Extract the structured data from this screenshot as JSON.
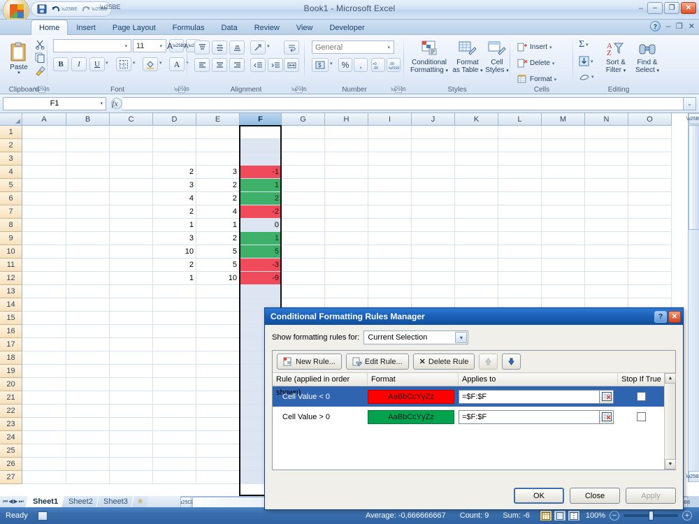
{
  "window": {
    "title": "Book1 - Microsoft Excel",
    "quick_access": [
      {
        "name": "save-icon",
        "glyph": "💾"
      },
      {
        "name": "undo-icon",
        "glyph": "↶"
      },
      {
        "name": "redo-icon",
        "glyph": "↷"
      }
    ],
    "customize_glyph": "▾",
    "minimize": "–",
    "maximize": "❐",
    "close": "✕",
    "restore_dash": "–"
  },
  "ribbon": {
    "tabs": [
      {
        "label": "Home",
        "active": true
      },
      {
        "label": "Insert",
        "active": false
      },
      {
        "label": "Page Layout",
        "active": false
      },
      {
        "label": "Formulas",
        "active": false
      },
      {
        "label": "Data",
        "active": false
      },
      {
        "label": "Review",
        "active": false
      },
      {
        "label": "View",
        "active": false
      },
      {
        "label": "Developer",
        "active": false
      }
    ],
    "help_label": "?",
    "ribbon_minimize": "–",
    "ribbon_restore": "❐",
    "ribbon_close": "✕",
    "groups": {
      "clipboard": {
        "label": "Clipboard",
        "paste_label": "Paste",
        "paste_arrow": "▾",
        "cut_icon": "✂",
        "copy_icon": "❐",
        "format_painter_icon": "🖌"
      },
      "font": {
        "label": "Font",
        "font_name_value": "",
        "font_size_value": "11",
        "grow_font": "A",
        "shrink_font": "A",
        "bold": "B",
        "italic": "I",
        "underline": "U",
        "borders_icon": "⊞",
        "fill_color_icon": "△",
        "font_color_icon": "A",
        "arrow": "▾"
      },
      "alignment": {
        "label": "Alignment",
        "align_top": "≡",
        "align_middle": "≡",
        "align_bottom": "≡",
        "orientation": "⟋",
        "align_left": "≡",
        "align_center": "≡",
        "align_right": "≡",
        "decrease_indent": "⇤",
        "increase_indent": "⇥",
        "wrap_text": "↵",
        "merge_center": "↔",
        "arrow": "▾"
      },
      "number": {
        "label": "Number",
        "format_value": "General",
        "accounting_icon": "💲",
        "percent_icon": "%",
        "comma_icon": ",",
        "increase_decimal": "→.00",
        "decrease_decimal": ".00←",
        "arrow": "▾"
      },
      "styles": {
        "label": "Styles",
        "conditional_formatting": "Conditional\nFormatting",
        "conditional_formatting_l1": "Conditional",
        "conditional_formatting_l2": "Formatting",
        "format_as_table_l1": "Format",
        "format_as_table_l2": "as Table",
        "cell_styles_l1": "Cell",
        "cell_styles_l2": "Styles",
        "arrow": "▾"
      },
      "cells": {
        "label": "Cells",
        "insert": "Insert",
        "delete": "Delete",
        "format": "Format",
        "arrow": "▾"
      },
      "editing": {
        "label": "Editing",
        "autosum": "Σ",
        "fill": "↓",
        "clear": "⊘",
        "sort_filter_l1": "Sort &",
        "sort_filter_l2": "Filter",
        "find_select_l1": "Find &",
        "find_select_l2": "Select",
        "arrow": "▾"
      }
    }
  },
  "formula_bar": {
    "name_box_value": "F1",
    "name_box_arrow": "▾",
    "fx_label": "fx",
    "formula_value": "",
    "expand_arrow": "⌄"
  },
  "grid": {
    "columns": [
      "A",
      "B",
      "C",
      "D",
      "E",
      "F",
      "G",
      "H",
      "I",
      "J",
      "K",
      "L",
      "M",
      "N",
      "O"
    ],
    "selected_column": "F",
    "rows": [
      "1",
      "2",
      "3",
      "4",
      "5",
      "6",
      "7",
      "8",
      "9",
      "10",
      "11",
      "12",
      "13",
      "14",
      "15",
      "16",
      "17",
      "18",
      "19",
      "20",
      "21",
      "22",
      "23",
      "24",
      "25",
      "26",
      "27"
    ],
    "data": [
      {
        "row": "1",
        "D": "",
        "E": "",
        "F": "",
        "F_fmt": "none"
      },
      {
        "row": "2",
        "D": "",
        "E": "",
        "F": "",
        "F_fmt": "plain"
      },
      {
        "row": "3",
        "D": "",
        "E": "",
        "F": "",
        "F_fmt": "plain"
      },
      {
        "row": "4",
        "D": "2",
        "E": "3",
        "F": "-1",
        "F_fmt": "red"
      },
      {
        "row": "5",
        "D": "3",
        "E": "2",
        "F": "1",
        "F_fmt": "green"
      },
      {
        "row": "6",
        "D": "4",
        "E": "2",
        "F": "2",
        "F_fmt": "green"
      },
      {
        "row": "7",
        "D": "2",
        "E": "4",
        "F": "-2",
        "F_fmt": "red"
      },
      {
        "row": "8",
        "D": "1",
        "E": "1",
        "F": "0",
        "F_fmt": "plain"
      },
      {
        "row": "9",
        "D": "3",
        "E": "2",
        "F": "1",
        "F_fmt": "green"
      },
      {
        "row": "10",
        "D": "10",
        "E": "5",
        "F": "5",
        "F_fmt": "green"
      },
      {
        "row": "11",
        "D": "2",
        "E": "5",
        "F": "-3",
        "F_fmt": "red"
      },
      {
        "row": "12",
        "D": "1",
        "E": "10",
        "F": "-9",
        "F_fmt": "red"
      }
    ]
  },
  "sheet_tabs": {
    "nav_first": "⏮",
    "nav_prev": "◀",
    "nav_next": "▶",
    "nav_last": "⏭",
    "tabs": [
      {
        "label": "Sheet1",
        "active": true
      },
      {
        "label": "Sheet2",
        "active": false
      },
      {
        "label": "Sheet3",
        "active": false
      }
    ],
    "insert_sheet_icon": "✳"
  },
  "status_bar": {
    "ready": "Ready",
    "average": "Average: -0,666666667",
    "count": "Count: 9",
    "sum": "Sum: -6",
    "zoom": "100%",
    "zoom_out": "−",
    "zoom_in": "+",
    "view_normal": "☷",
    "view_layout": "▣",
    "view_break": "▥"
  },
  "dialog": {
    "title": "Conditional Formatting Rules Manager",
    "help_btn": "?",
    "close_btn": "✕",
    "show_rules_label": "Show formatting rules for:",
    "show_rules_value": "Current Selection",
    "combo_arrow": "▾",
    "toolbar": {
      "new_rule": "New Rule...",
      "edit_rule": "Edit Rule...",
      "delete_rule": "Delete Rule",
      "delete_icon": "✕",
      "move_up": "⬆",
      "move_down": "⬇"
    },
    "headers": {
      "rule": "Rule (applied in order shown)",
      "format": "Format",
      "applies_to": "Applies to",
      "stop_if_true": "Stop If True"
    },
    "rules": [
      {
        "rule": "Cell Value < 0",
        "format_preview": "AaBbCcYyZz",
        "format_bg": "#FF0000",
        "format_fg": "#1a1a1a",
        "applies_to": "=$F:$F",
        "stop_if_true": false,
        "selected": true
      },
      {
        "rule": "Cell Value > 0",
        "format_preview": "AaBbCcYyZz",
        "format_bg": "#00A24E",
        "format_fg": "#1a1a1a",
        "applies_to": "=$F:$F",
        "stop_if_true": false,
        "selected": false
      }
    ],
    "scroll_up": "▲",
    "scroll_down": "▼",
    "buttons": {
      "ok": "OK",
      "close": "Close",
      "apply": "Apply"
    }
  },
  "colors": {
    "accent": "#1a5fb4",
    "red_rule": "#FF0000",
    "green_rule": "#00A24E",
    "cell_red": "#f04b5a",
    "cell_green": "#3fb06a",
    "selection": "#2f64b0"
  }
}
